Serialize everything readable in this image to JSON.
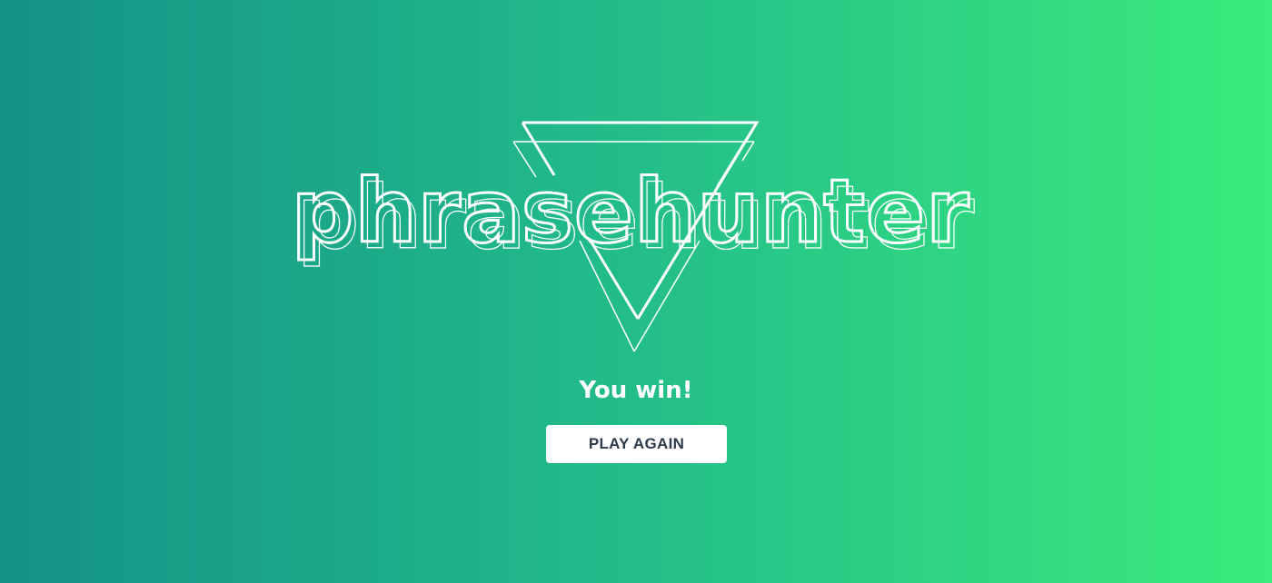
{
  "title": "phrasehunter",
  "message": "You win!",
  "button": {
    "label": "PLAY AGAIN"
  },
  "colors": {
    "gradient_start": "#149186",
    "gradient_end": "#3aec7c",
    "outline": "#ffffff",
    "button_text": "#2c3a4a"
  },
  "icons": [
    "triangle-outline-icon"
  ]
}
